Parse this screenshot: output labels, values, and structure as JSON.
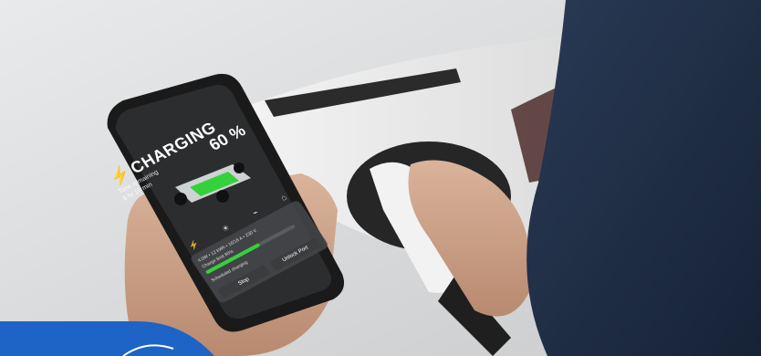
{
  "charging": {
    "title": "CHARGING",
    "percent": "60 %",
    "time_remaining_label": "Time remaining",
    "time_remaining_value": "6 hr 10 min",
    "level": 0.6
  },
  "panel": {
    "stats": "4.0W • 12 kWh • 16/16 A • 230 V",
    "limit_label": "Charge limit 80%",
    "row_label": "Scheduled charging",
    "stop_label": "Stop",
    "unlock_label": "Unlock Port"
  },
  "icons": [
    "bolt-icon",
    "temperature-icon",
    "thermometer-icon",
    "lock-icon"
  ],
  "colors": {
    "accent": "#35d13a",
    "screen": "#2b2d2f",
    "banner": "#1e63c6"
  }
}
